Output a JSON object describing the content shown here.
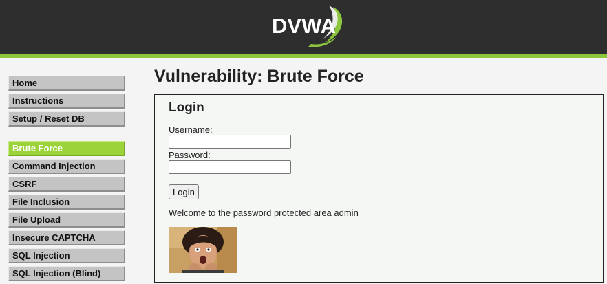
{
  "header": {
    "logo_text": "DVWA",
    "colors": {
      "background": "#2e2e2e",
      "accent": "#8cc63f"
    }
  },
  "sidebar": {
    "groups": [
      [
        {
          "label": "Home"
        },
        {
          "label": "Instructions"
        },
        {
          "label": "Setup / Reset DB"
        }
      ],
      [
        {
          "label": "Brute Force",
          "active": true
        },
        {
          "label": "Command Injection"
        },
        {
          "label": "CSRF"
        },
        {
          "label": "File Inclusion"
        },
        {
          "label": "File Upload"
        },
        {
          "label": "Insecure CAPTCHA"
        },
        {
          "label": "SQL Injection"
        },
        {
          "label": "SQL Injection (Blind)"
        }
      ]
    ],
    "colors": {
      "item": "#c4c4c4",
      "active": "#9cd33a"
    }
  },
  "main": {
    "title": "Vulnerability: Brute Force",
    "form": {
      "heading": "Login",
      "username_label": "Username:",
      "username_value": "",
      "password_label": "Password:",
      "password_value": "",
      "button_label": "Login"
    },
    "welcome_message": "Welcome to the password protected area admin",
    "image": "user-avatar-photo"
  }
}
